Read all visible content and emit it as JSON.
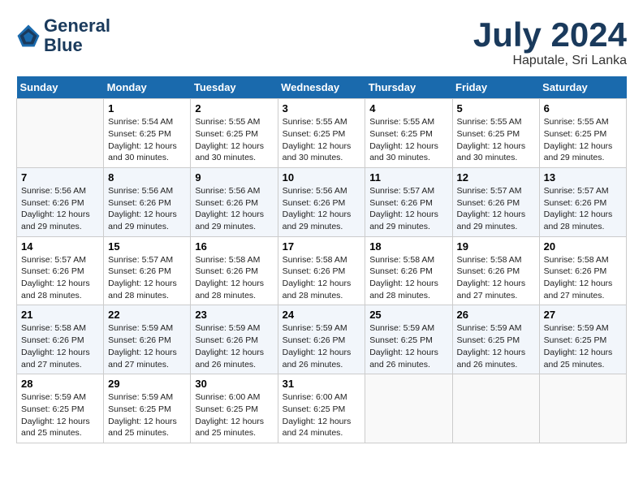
{
  "header": {
    "logo_line1": "General",
    "logo_line2": "Blue",
    "month_year": "July 2024",
    "location": "Haputale, Sri Lanka"
  },
  "weekdays": [
    "Sunday",
    "Monday",
    "Tuesday",
    "Wednesday",
    "Thursday",
    "Friday",
    "Saturday"
  ],
  "weeks": [
    [
      {
        "day": "",
        "info": ""
      },
      {
        "day": "1",
        "info": "Sunrise: 5:54 AM\nSunset: 6:25 PM\nDaylight: 12 hours\nand 30 minutes."
      },
      {
        "day": "2",
        "info": "Sunrise: 5:55 AM\nSunset: 6:25 PM\nDaylight: 12 hours\nand 30 minutes."
      },
      {
        "day": "3",
        "info": "Sunrise: 5:55 AM\nSunset: 6:25 PM\nDaylight: 12 hours\nand 30 minutes."
      },
      {
        "day": "4",
        "info": "Sunrise: 5:55 AM\nSunset: 6:25 PM\nDaylight: 12 hours\nand 30 minutes."
      },
      {
        "day": "5",
        "info": "Sunrise: 5:55 AM\nSunset: 6:25 PM\nDaylight: 12 hours\nand 30 minutes."
      },
      {
        "day": "6",
        "info": "Sunrise: 5:55 AM\nSunset: 6:25 PM\nDaylight: 12 hours\nand 29 minutes."
      }
    ],
    [
      {
        "day": "7",
        "info": "Sunrise: 5:56 AM\nSunset: 6:26 PM\nDaylight: 12 hours\nand 29 minutes."
      },
      {
        "day": "8",
        "info": "Sunrise: 5:56 AM\nSunset: 6:26 PM\nDaylight: 12 hours\nand 29 minutes."
      },
      {
        "day": "9",
        "info": "Sunrise: 5:56 AM\nSunset: 6:26 PM\nDaylight: 12 hours\nand 29 minutes."
      },
      {
        "day": "10",
        "info": "Sunrise: 5:56 AM\nSunset: 6:26 PM\nDaylight: 12 hours\nand 29 minutes."
      },
      {
        "day": "11",
        "info": "Sunrise: 5:57 AM\nSunset: 6:26 PM\nDaylight: 12 hours\nand 29 minutes."
      },
      {
        "day": "12",
        "info": "Sunrise: 5:57 AM\nSunset: 6:26 PM\nDaylight: 12 hours\nand 29 minutes."
      },
      {
        "day": "13",
        "info": "Sunrise: 5:57 AM\nSunset: 6:26 PM\nDaylight: 12 hours\nand 28 minutes."
      }
    ],
    [
      {
        "day": "14",
        "info": "Sunrise: 5:57 AM\nSunset: 6:26 PM\nDaylight: 12 hours\nand 28 minutes."
      },
      {
        "day": "15",
        "info": "Sunrise: 5:57 AM\nSunset: 6:26 PM\nDaylight: 12 hours\nand 28 minutes."
      },
      {
        "day": "16",
        "info": "Sunrise: 5:58 AM\nSunset: 6:26 PM\nDaylight: 12 hours\nand 28 minutes."
      },
      {
        "day": "17",
        "info": "Sunrise: 5:58 AM\nSunset: 6:26 PM\nDaylight: 12 hours\nand 28 minutes."
      },
      {
        "day": "18",
        "info": "Sunrise: 5:58 AM\nSunset: 6:26 PM\nDaylight: 12 hours\nand 28 minutes."
      },
      {
        "day": "19",
        "info": "Sunrise: 5:58 AM\nSunset: 6:26 PM\nDaylight: 12 hours\nand 27 minutes."
      },
      {
        "day": "20",
        "info": "Sunrise: 5:58 AM\nSunset: 6:26 PM\nDaylight: 12 hours\nand 27 minutes."
      }
    ],
    [
      {
        "day": "21",
        "info": "Sunrise: 5:58 AM\nSunset: 6:26 PM\nDaylight: 12 hours\nand 27 minutes."
      },
      {
        "day": "22",
        "info": "Sunrise: 5:59 AM\nSunset: 6:26 PM\nDaylight: 12 hours\nand 27 minutes."
      },
      {
        "day": "23",
        "info": "Sunrise: 5:59 AM\nSunset: 6:26 PM\nDaylight: 12 hours\nand 26 minutes."
      },
      {
        "day": "24",
        "info": "Sunrise: 5:59 AM\nSunset: 6:26 PM\nDaylight: 12 hours\nand 26 minutes."
      },
      {
        "day": "25",
        "info": "Sunrise: 5:59 AM\nSunset: 6:25 PM\nDaylight: 12 hours\nand 26 minutes."
      },
      {
        "day": "26",
        "info": "Sunrise: 5:59 AM\nSunset: 6:25 PM\nDaylight: 12 hours\nand 26 minutes."
      },
      {
        "day": "27",
        "info": "Sunrise: 5:59 AM\nSunset: 6:25 PM\nDaylight: 12 hours\nand 25 minutes."
      }
    ],
    [
      {
        "day": "28",
        "info": "Sunrise: 5:59 AM\nSunset: 6:25 PM\nDaylight: 12 hours\nand 25 minutes."
      },
      {
        "day": "29",
        "info": "Sunrise: 5:59 AM\nSunset: 6:25 PM\nDaylight: 12 hours\nand 25 minutes."
      },
      {
        "day": "30",
        "info": "Sunrise: 6:00 AM\nSunset: 6:25 PM\nDaylight: 12 hours\nand 25 minutes."
      },
      {
        "day": "31",
        "info": "Sunrise: 6:00 AM\nSunset: 6:25 PM\nDaylight: 12 hours\nand 24 minutes."
      },
      {
        "day": "",
        "info": ""
      },
      {
        "day": "",
        "info": ""
      },
      {
        "day": "",
        "info": ""
      }
    ]
  ]
}
